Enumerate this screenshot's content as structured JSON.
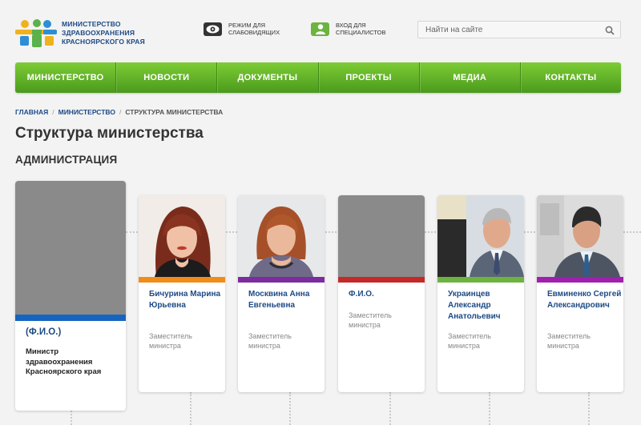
{
  "header": {
    "logo_text": [
      "МИНИСТЕРСТВО",
      "ЗДРАВООХРАНЕНИЯ",
      "КРАСНОЯРСКОГО КРАЯ"
    ],
    "accessibility": {
      "line1": "Режим для",
      "line2": "слабовидящих",
      "icon": "eye-icon"
    },
    "specialists": {
      "line1": "Вход для",
      "line2": "специалистов",
      "icon": "user-icon"
    },
    "search_placeholder": "Найти на сайте",
    "search_icon": "search-icon"
  },
  "nav": [
    "МИНИСТЕРСТВО",
    "НОВОСТИ",
    "ДОКУМЕНТЫ",
    "ПРОЕКТЫ",
    "МЕДИА",
    "КОНТАКТЫ"
  ],
  "breadcrumb": {
    "home": "ГЛАВНАЯ",
    "parent": "МИНИСТЕРСТВО",
    "current": "СТРУКТУРА МИНИСТЕРСТВА",
    "sep": "/"
  },
  "page_title": "Структура министерства",
  "section_title": "АДМИНИСТРАЦИЯ",
  "minister": {
    "name": "(Ф.И.О.)",
    "position": "Министр здравоохранения Красноярского края",
    "accent": "#1565c0"
  },
  "deputies": [
    {
      "name": "Бичурина Марина Юрьевна",
      "position": "Заместитель министра",
      "accent": "#f08c1a"
    },
    {
      "name": "Москвина Анна Евгеньевна",
      "position": "Заместитель министра",
      "accent": "#7b2c9e"
    },
    {
      "name": "Ф.И.О.",
      "position": "Заместитель министра",
      "accent": "#c62828"
    },
    {
      "name": "Украинцев Александр Анатольевич",
      "position": "Заместитель министра",
      "accent": "#6db33f"
    },
    {
      "name": "Евминенко Сергей Александрович",
      "position": "Заместитель министра",
      "accent": "#a11fb0"
    }
  ]
}
